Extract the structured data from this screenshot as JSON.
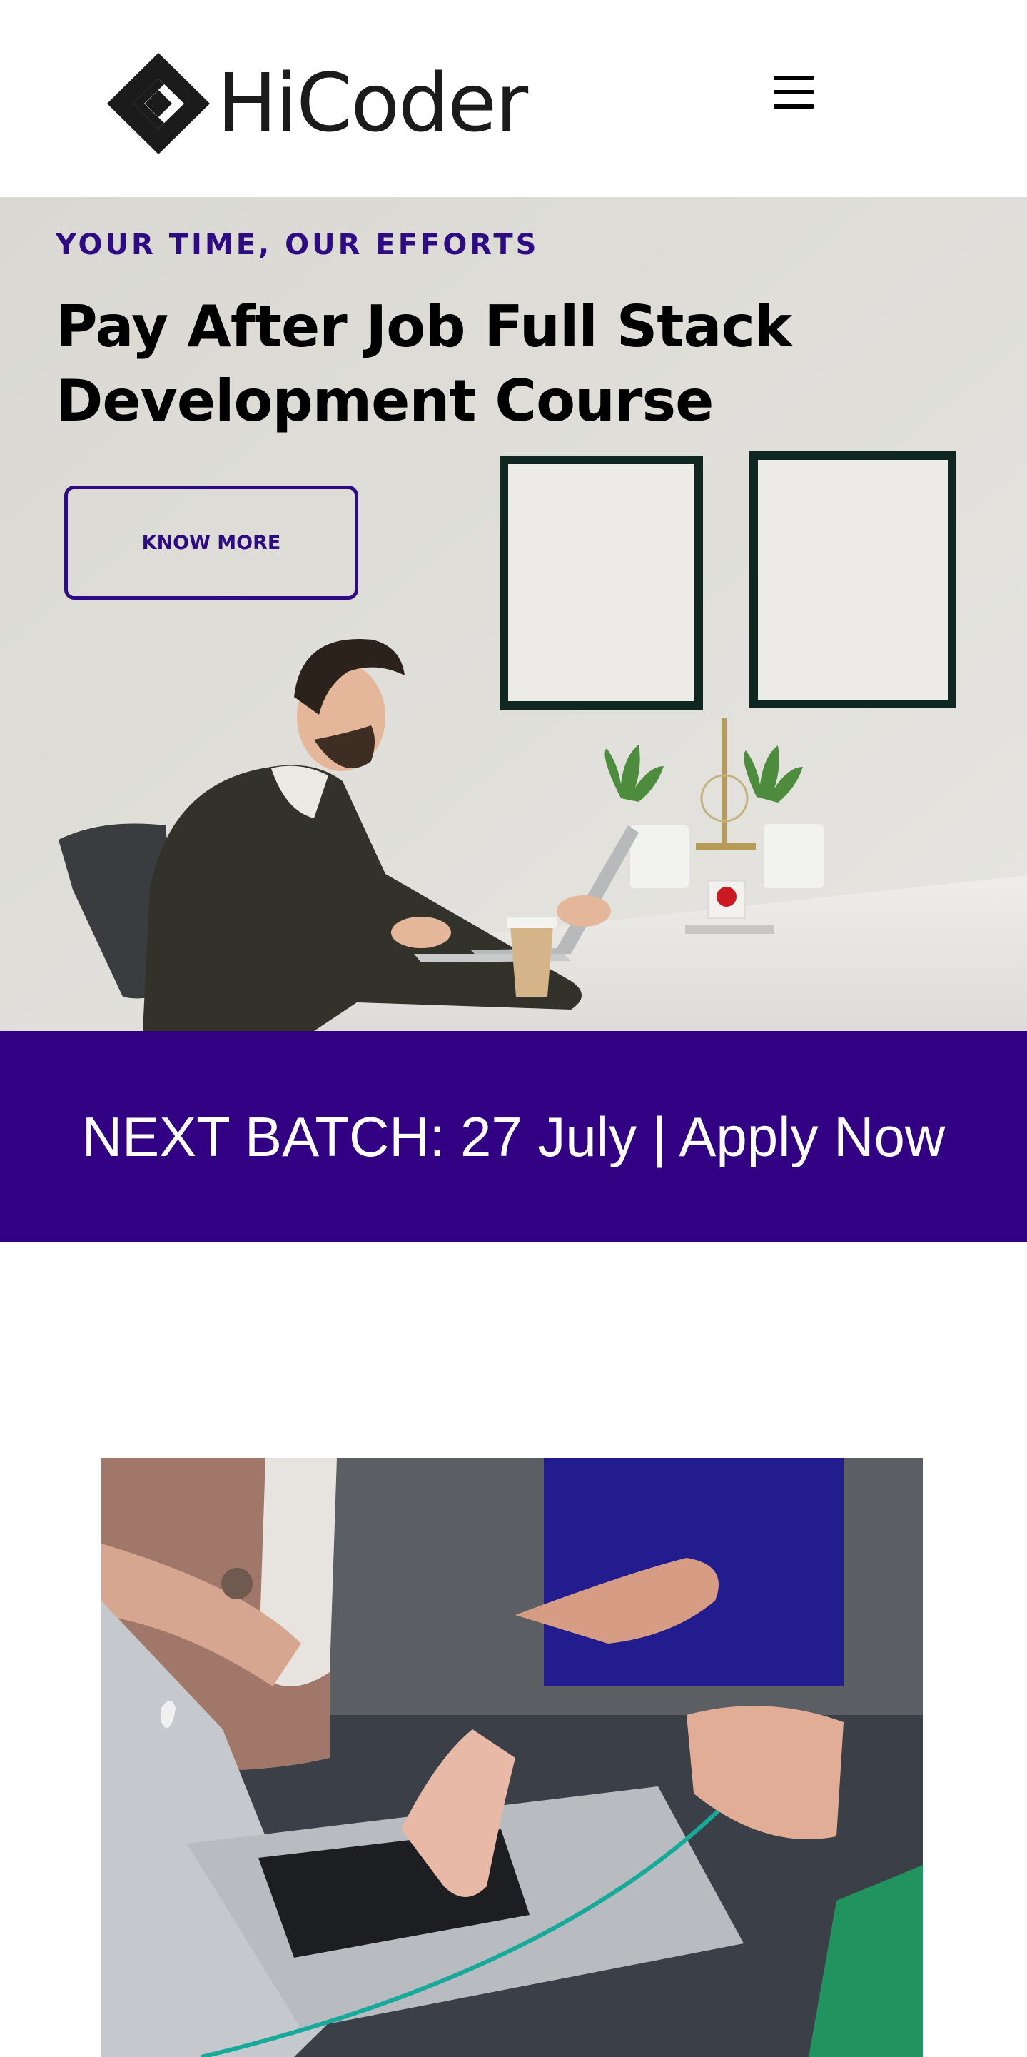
{
  "header": {
    "logo_text": "HiCoder",
    "menu_icon": "hamburger-menu-icon"
  },
  "hero": {
    "tagline": "YOUR TIME, OUR EFFORTS",
    "title": "Pay After Job Full Stack Development Course",
    "cta_label": "KNOW MORE"
  },
  "banner": {
    "text": "NEXT BATCH: 27 July | Apply Now"
  },
  "colors": {
    "brand": "#2e0b82",
    "banner_bg": "#320082",
    "text_dark": "#000000"
  }
}
